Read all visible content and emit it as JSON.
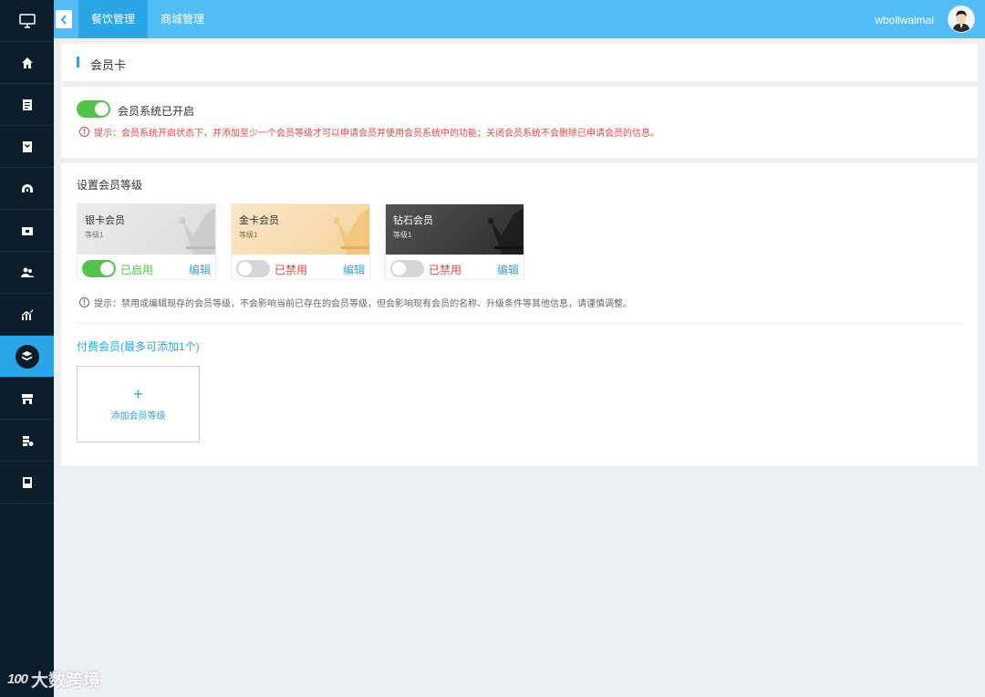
{
  "sidebar": {
    "items": [
      {
        "icon": "monitor-icon"
      },
      {
        "icon": "home-icon"
      },
      {
        "icon": "document-icon"
      },
      {
        "icon": "inbox-icon"
      },
      {
        "icon": "dashboard-icon"
      },
      {
        "icon": "wallet-icon"
      },
      {
        "icon": "users-icon"
      },
      {
        "icon": "stats-icon"
      },
      {
        "icon": "layers-icon",
        "active": true
      },
      {
        "icon": "store-icon"
      },
      {
        "icon": "settings-icon"
      },
      {
        "icon": "book-icon"
      }
    ]
  },
  "header": {
    "tabs": [
      {
        "label": "餐饮管理",
        "active": true
      },
      {
        "label": "商城管理",
        "active": false
      }
    ],
    "username": "wbollwaimai"
  },
  "page": {
    "title": "会员卡"
  },
  "member_system": {
    "label": "会员系统已开启",
    "enabled": true,
    "hint": "提示：会员系统开启状态下，并添加至少一个会员等级才可以申请会员并使用会员系统中的功能；关闭会员系统不会删除已申请会员的信息。"
  },
  "levels": {
    "title": "设置会员等级",
    "cards": [
      {
        "name": "银卡会员",
        "level": "等级1",
        "status": "已启用",
        "enabled": true,
        "edit": "编辑"
      },
      {
        "name": "金卡会员",
        "level": "等级1",
        "status": "已禁用",
        "enabled": false,
        "edit": "编辑"
      },
      {
        "name": "钻石会员",
        "level": "等级1",
        "status": "已禁用",
        "enabled": false,
        "edit": "编辑"
      }
    ],
    "tip": "提示：禁用或编辑现存的会员等级，不会影响当前已存在的会员等级，但会影响现有会员的名称、升级条件等其他信息，请谨慎调整。"
  },
  "paid": {
    "title": "付费会员(最多可添加1个)",
    "add_icon": "+",
    "add_label": "添加会员等级"
  },
  "watermark": {
    "logo": "100",
    "text": "大数跨境"
  },
  "colors": {
    "primary": "#2aa6e8",
    "topbar": "#52bdf5",
    "sidebar": "#0b1d2b",
    "enabled": "#52c44a",
    "disabled": "#e64545"
  }
}
